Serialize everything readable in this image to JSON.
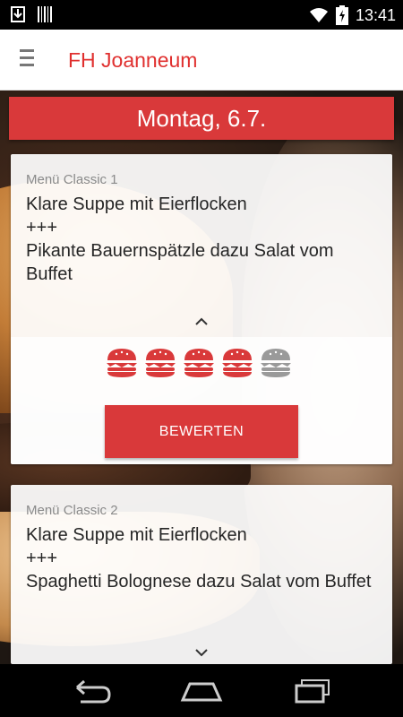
{
  "status_bar": {
    "time": "13:41",
    "icons": [
      "download-icon",
      "barcode-icon",
      "wifi-icon",
      "battery-charging-icon"
    ]
  },
  "app_bar": {
    "title": "FH Joanneum",
    "menu_icon": "hamburger-menu-icon"
  },
  "day_header": "Montag, 6.7.",
  "menus": [
    {
      "label": "Menü Classic 1",
      "dish": "Klare Suppe mit Eierflocken\n+++\nPikante Bauernspätzle dazu Salat vom Buffet",
      "expand_icon": "chevron-up-icon",
      "rating": {
        "value": 4,
        "max": 5
      },
      "button_label": "BEWERTEN"
    },
    {
      "label": "Menü Classic 2",
      "dish": "Klare Suppe mit Eierflocken\n+++\nSpaghetti Bolognese dazu Salat vom Buffet",
      "expand_icon": "chevron-down-icon"
    }
  ],
  "colors": {
    "accent": "#d9393a",
    "title": "#e0302f",
    "rating_inactive": "#9a9a9a"
  },
  "nav_bar": {
    "icons": [
      "back-icon",
      "home-icon",
      "recent-apps-icon"
    ]
  }
}
